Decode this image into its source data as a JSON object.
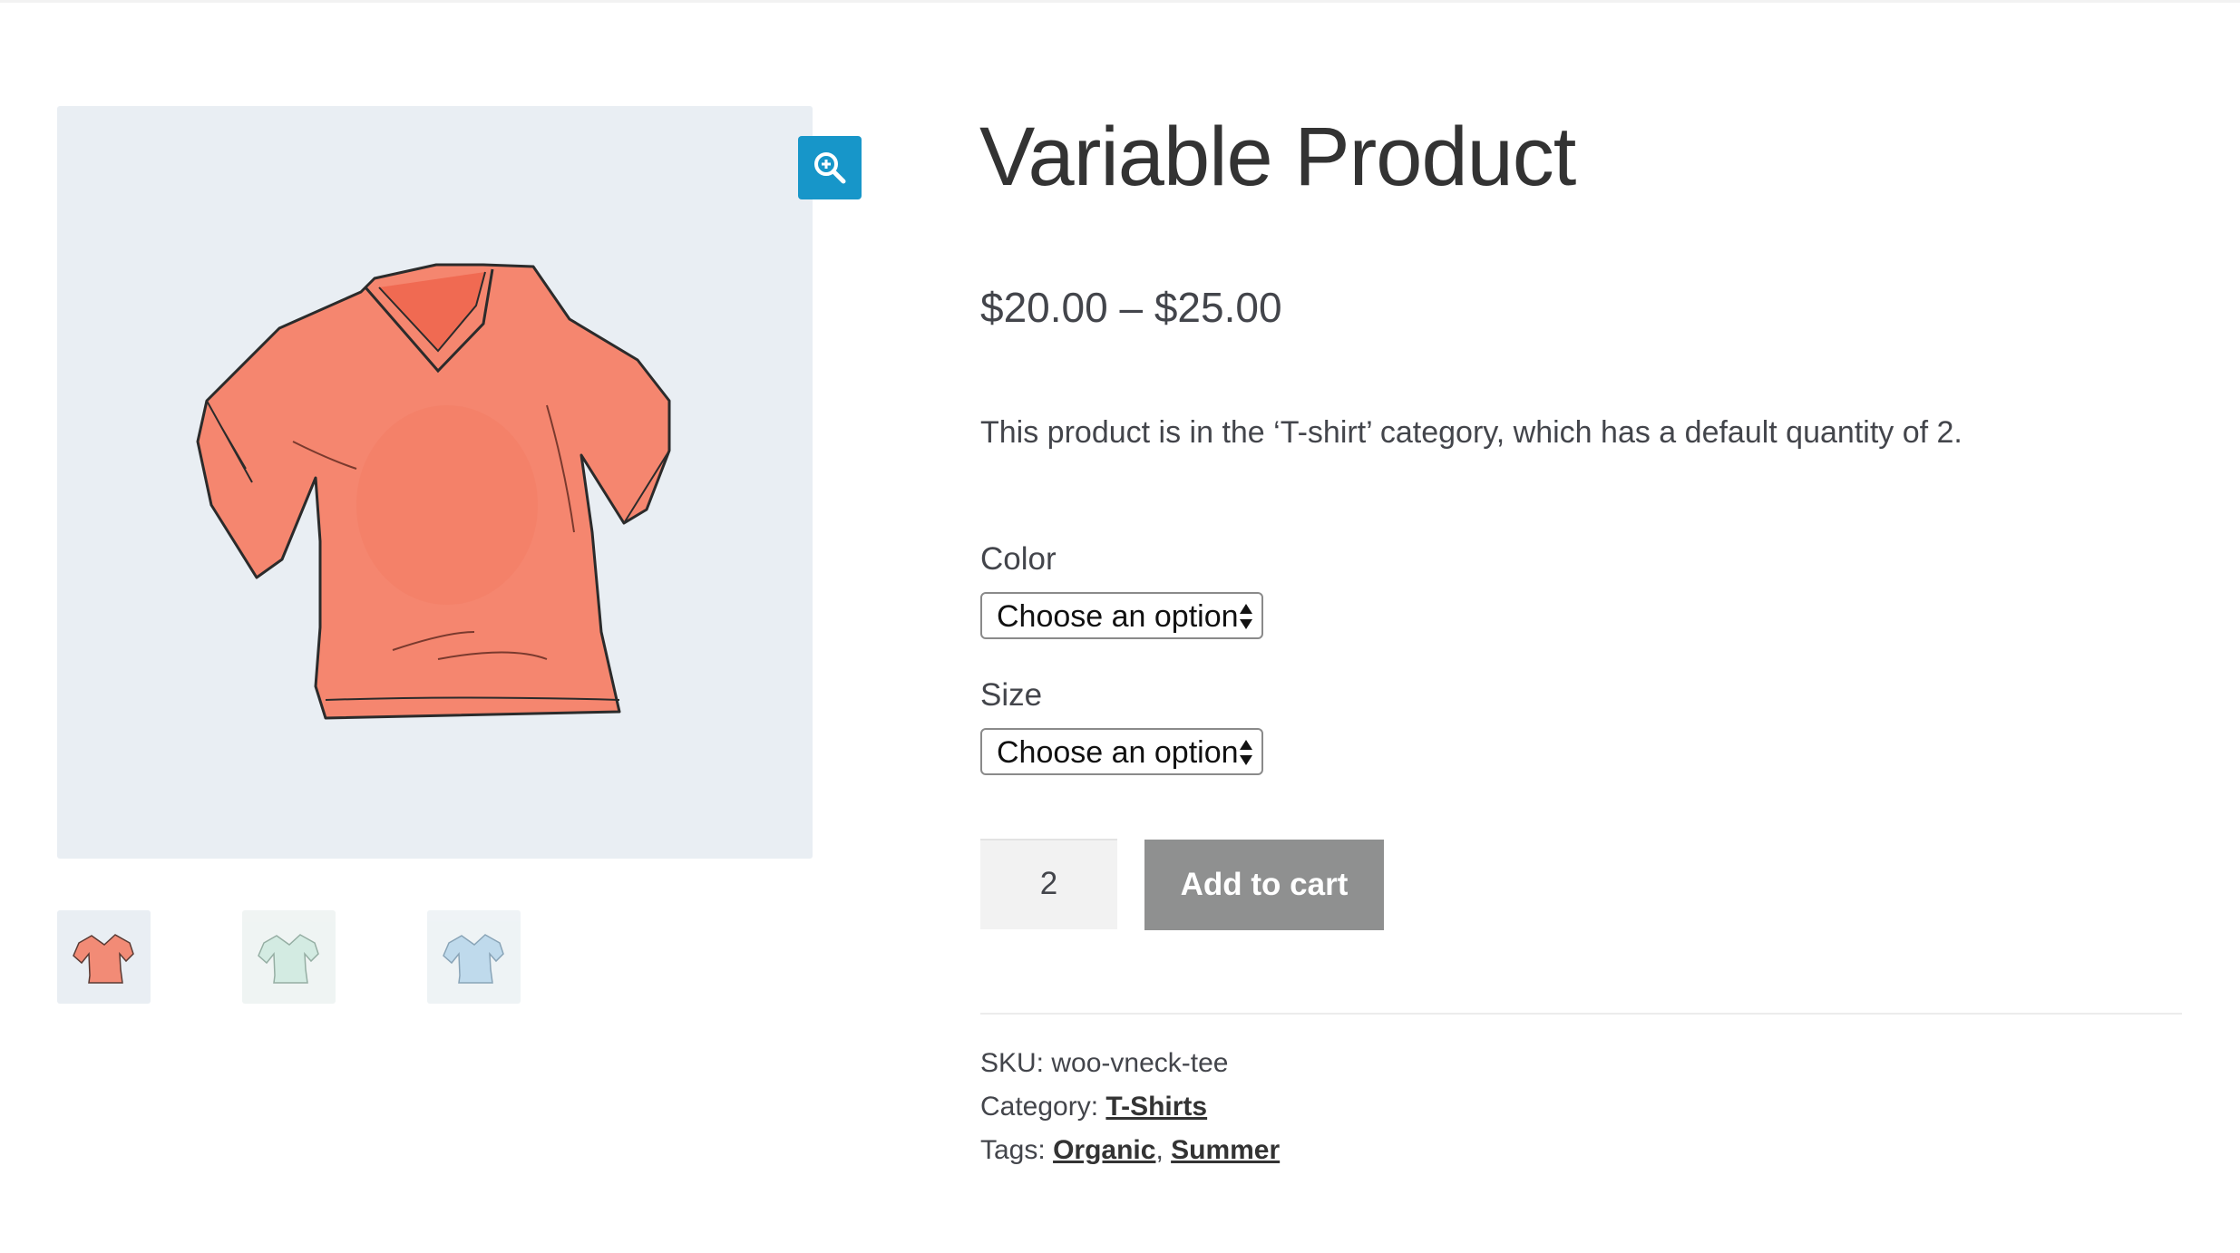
{
  "product": {
    "title": "Variable Product",
    "price": "$20.00 – $25.00",
    "description": "This product is in the ‘T-shirt’ category, which has a default quantity of 2."
  },
  "gallery": {
    "zoom_icon": "zoom-in-magnifier-icon",
    "main_image_color": "#f5866f",
    "thumbnails": [
      {
        "color": "#f28b76"
      },
      {
        "color": "#cfe9df"
      },
      {
        "color": "#b9d6ea"
      }
    ]
  },
  "variations": {
    "color": {
      "label": "Color",
      "selected": "Choose an option"
    },
    "size": {
      "label": "Size",
      "selected": "Choose an option"
    }
  },
  "cart": {
    "quantity": "2",
    "add_to_cart_label": "Add to cart"
  },
  "meta": {
    "sku_label": "SKU:",
    "sku": "woo-vneck-tee",
    "category_label": "Category:",
    "category": "T-Shirts",
    "tags_label": "Tags:",
    "tags": [
      "Organic",
      "Summer"
    ],
    "tag_separator": ","
  },
  "colors": {
    "accent": "#1796c9",
    "button_disabled": "#8f9090",
    "image_background": "#e9eef3"
  }
}
